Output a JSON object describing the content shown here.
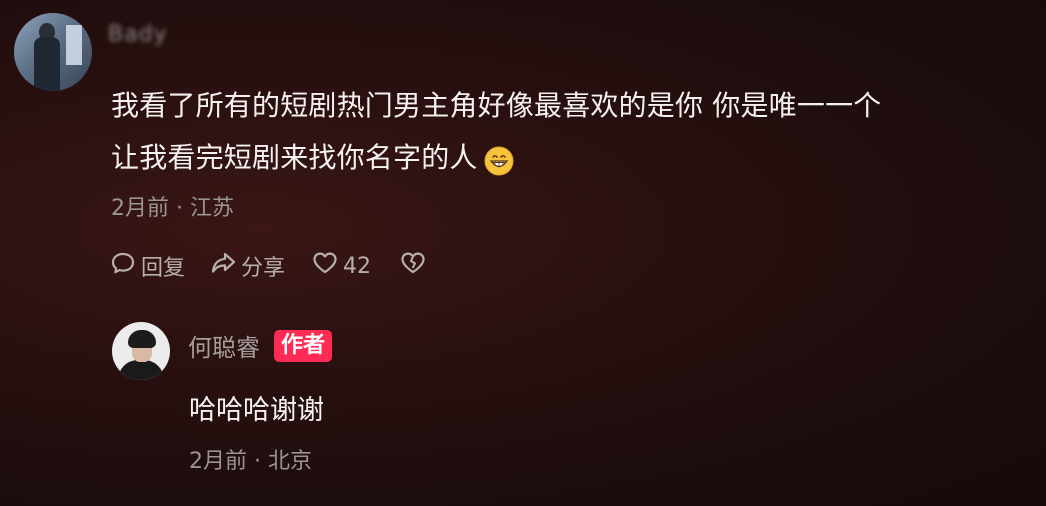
{
  "comment": {
    "username": "Bady",
    "text_line1": "我看了所有的短剧热门男主角好像最喜欢的是你 你是唯一一个",
    "text_line2": "让我看完短剧来找你名字的人",
    "emoji": "grinning-face",
    "time": "2月前",
    "separator": "·",
    "location": "江苏",
    "actions": {
      "reply_label": "回复",
      "share_label": "分享",
      "like_count": "42"
    }
  },
  "reply": {
    "username": "何聪睿",
    "badge": "作者",
    "text": "哈哈哈谢谢",
    "time": "2月前",
    "separator": "·",
    "location": "北京"
  },
  "colors": {
    "background": "#2a1010",
    "badge": "#fe2c55",
    "meta_text": "#9b9493",
    "body_text": "#f4f1f0"
  }
}
